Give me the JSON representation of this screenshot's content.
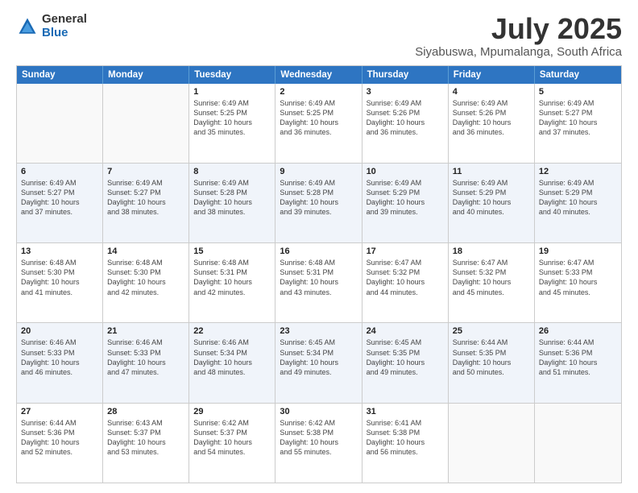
{
  "logo": {
    "general": "General",
    "blue": "Blue"
  },
  "title": "July 2025",
  "subtitle": "Siyabuswa, Mpumalanga, South Africa",
  "header_days": [
    "Sunday",
    "Monday",
    "Tuesday",
    "Wednesday",
    "Thursday",
    "Friday",
    "Saturday"
  ],
  "rows": [
    [
      {
        "day": "",
        "text": ""
      },
      {
        "day": "",
        "text": ""
      },
      {
        "day": "1",
        "text": "Sunrise: 6:49 AM\nSunset: 5:25 PM\nDaylight: 10 hours\nand 35 minutes."
      },
      {
        "day": "2",
        "text": "Sunrise: 6:49 AM\nSunset: 5:25 PM\nDaylight: 10 hours\nand 36 minutes."
      },
      {
        "day": "3",
        "text": "Sunrise: 6:49 AM\nSunset: 5:26 PM\nDaylight: 10 hours\nand 36 minutes."
      },
      {
        "day": "4",
        "text": "Sunrise: 6:49 AM\nSunset: 5:26 PM\nDaylight: 10 hours\nand 36 minutes."
      },
      {
        "day": "5",
        "text": "Sunrise: 6:49 AM\nSunset: 5:27 PM\nDaylight: 10 hours\nand 37 minutes."
      }
    ],
    [
      {
        "day": "6",
        "text": "Sunrise: 6:49 AM\nSunset: 5:27 PM\nDaylight: 10 hours\nand 37 minutes."
      },
      {
        "day": "7",
        "text": "Sunrise: 6:49 AM\nSunset: 5:27 PM\nDaylight: 10 hours\nand 38 minutes."
      },
      {
        "day": "8",
        "text": "Sunrise: 6:49 AM\nSunset: 5:28 PM\nDaylight: 10 hours\nand 38 minutes."
      },
      {
        "day": "9",
        "text": "Sunrise: 6:49 AM\nSunset: 5:28 PM\nDaylight: 10 hours\nand 39 minutes."
      },
      {
        "day": "10",
        "text": "Sunrise: 6:49 AM\nSunset: 5:29 PM\nDaylight: 10 hours\nand 39 minutes."
      },
      {
        "day": "11",
        "text": "Sunrise: 6:49 AM\nSunset: 5:29 PM\nDaylight: 10 hours\nand 40 minutes."
      },
      {
        "day": "12",
        "text": "Sunrise: 6:49 AM\nSunset: 5:29 PM\nDaylight: 10 hours\nand 40 minutes."
      }
    ],
    [
      {
        "day": "13",
        "text": "Sunrise: 6:48 AM\nSunset: 5:30 PM\nDaylight: 10 hours\nand 41 minutes."
      },
      {
        "day": "14",
        "text": "Sunrise: 6:48 AM\nSunset: 5:30 PM\nDaylight: 10 hours\nand 42 minutes."
      },
      {
        "day": "15",
        "text": "Sunrise: 6:48 AM\nSunset: 5:31 PM\nDaylight: 10 hours\nand 42 minutes."
      },
      {
        "day": "16",
        "text": "Sunrise: 6:48 AM\nSunset: 5:31 PM\nDaylight: 10 hours\nand 43 minutes."
      },
      {
        "day": "17",
        "text": "Sunrise: 6:47 AM\nSunset: 5:32 PM\nDaylight: 10 hours\nand 44 minutes."
      },
      {
        "day": "18",
        "text": "Sunrise: 6:47 AM\nSunset: 5:32 PM\nDaylight: 10 hours\nand 45 minutes."
      },
      {
        "day": "19",
        "text": "Sunrise: 6:47 AM\nSunset: 5:33 PM\nDaylight: 10 hours\nand 45 minutes."
      }
    ],
    [
      {
        "day": "20",
        "text": "Sunrise: 6:46 AM\nSunset: 5:33 PM\nDaylight: 10 hours\nand 46 minutes."
      },
      {
        "day": "21",
        "text": "Sunrise: 6:46 AM\nSunset: 5:33 PM\nDaylight: 10 hours\nand 47 minutes."
      },
      {
        "day": "22",
        "text": "Sunrise: 6:46 AM\nSunset: 5:34 PM\nDaylight: 10 hours\nand 48 minutes."
      },
      {
        "day": "23",
        "text": "Sunrise: 6:45 AM\nSunset: 5:34 PM\nDaylight: 10 hours\nand 49 minutes."
      },
      {
        "day": "24",
        "text": "Sunrise: 6:45 AM\nSunset: 5:35 PM\nDaylight: 10 hours\nand 49 minutes."
      },
      {
        "day": "25",
        "text": "Sunrise: 6:44 AM\nSunset: 5:35 PM\nDaylight: 10 hours\nand 50 minutes."
      },
      {
        "day": "26",
        "text": "Sunrise: 6:44 AM\nSunset: 5:36 PM\nDaylight: 10 hours\nand 51 minutes."
      }
    ],
    [
      {
        "day": "27",
        "text": "Sunrise: 6:44 AM\nSunset: 5:36 PM\nDaylight: 10 hours\nand 52 minutes."
      },
      {
        "day": "28",
        "text": "Sunrise: 6:43 AM\nSunset: 5:37 PM\nDaylight: 10 hours\nand 53 minutes."
      },
      {
        "day": "29",
        "text": "Sunrise: 6:42 AM\nSunset: 5:37 PM\nDaylight: 10 hours\nand 54 minutes."
      },
      {
        "day": "30",
        "text": "Sunrise: 6:42 AM\nSunset: 5:38 PM\nDaylight: 10 hours\nand 55 minutes."
      },
      {
        "day": "31",
        "text": "Sunrise: 6:41 AM\nSunset: 5:38 PM\nDaylight: 10 hours\nand 56 minutes."
      },
      {
        "day": "",
        "text": ""
      },
      {
        "day": "",
        "text": ""
      }
    ]
  ]
}
